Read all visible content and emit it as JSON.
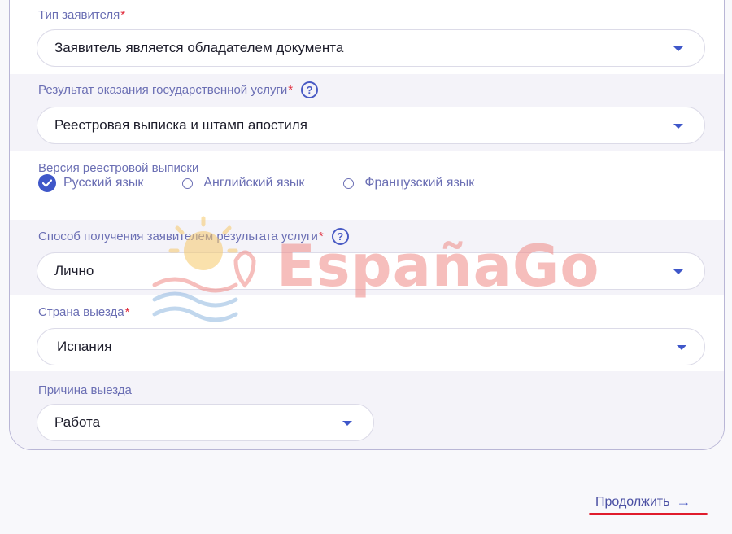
{
  "form": {
    "applicant_type": {
      "label": "Тип заявителя",
      "required_mark": "*",
      "value": "Заявитель является обладателем документа"
    },
    "service_result": {
      "label": "Результат оказания государственной услуги",
      "required_mark": "*",
      "help": "?",
      "value": "Реестровая выписка и штамп апостиля"
    },
    "extract_version": {
      "label": "Версия реестровой выписки",
      "options": [
        {
          "label": "Русский язык",
          "checked": true
        },
        {
          "label": "Английский язык",
          "checked": false
        },
        {
          "label": "Французский язык",
          "checked": false
        }
      ]
    },
    "receipt_method": {
      "label": "Способ получения заявителем результата услуги",
      "required_mark": "*",
      "help": "?",
      "value": "Лично"
    },
    "destination_country": {
      "label": "Страна выезда",
      "required_mark": "*",
      "value": "Испания"
    },
    "departure_reason": {
      "label": "Причина выезда",
      "value": "Работа"
    }
  },
  "footer": {
    "continue_label": "Продолжить",
    "continue_arrow": "→"
  },
  "watermark": {
    "text": "EspañaGo"
  },
  "colors": {
    "accent": "#3f57c9",
    "label": "#6b6fb4",
    "required": "#e02a3a",
    "underline": "#e01c2c"
  }
}
